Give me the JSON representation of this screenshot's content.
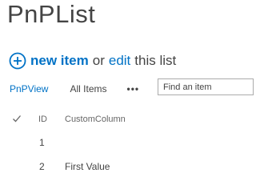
{
  "list": {
    "title": "PnPList"
  },
  "command_bar": {
    "new_item_label": "new item",
    "or_text": "or",
    "edit_label": "edit",
    "this_list_text": "this list",
    "add_icon": "circle-plus-icon"
  },
  "views": {
    "current": "PnPView",
    "all_items": "All Items",
    "more": "•••"
  },
  "search": {
    "placeholder": "Find an item"
  },
  "table": {
    "columns": [
      "ID",
      "CustomColumn"
    ],
    "rows": [
      {
        "id": "1",
        "custom": ""
      },
      {
        "id": "2",
        "custom": "First Value"
      }
    ]
  },
  "colors": {
    "accent": "#0072c6",
    "text": "#444444"
  }
}
